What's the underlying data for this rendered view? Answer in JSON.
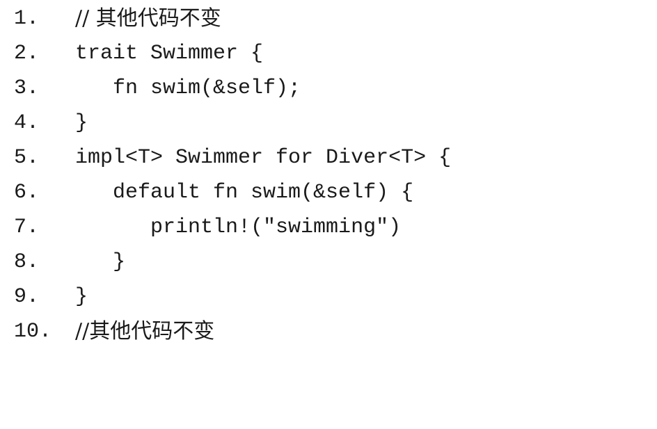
{
  "code_lines": [
    {
      "number": "1.",
      "text": "// 其他代码不变"
    },
    {
      "number": "2.",
      "text": "trait Swimmer {"
    },
    {
      "number": "3.",
      "text": "   fn swim(&self);"
    },
    {
      "number": "4.",
      "text": "}"
    },
    {
      "number": "5.",
      "text": "impl<T> Swimmer for Diver<T> {"
    },
    {
      "number": "6.",
      "text": "   default fn swim(&self) {"
    },
    {
      "number": "7.",
      "text": "      println!(\"swimming\")"
    },
    {
      "number": "8.",
      "text": "   }"
    },
    {
      "number": "9.",
      "text": "}"
    },
    {
      "number": "10.",
      "text": "//其他代码不变"
    }
  ]
}
